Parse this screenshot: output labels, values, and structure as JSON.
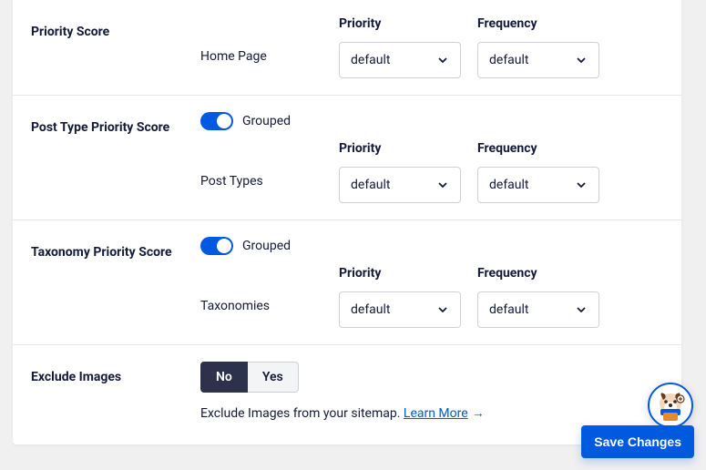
{
  "sections": {
    "priority": {
      "label": "Priority Score",
      "row_label": "Home Page",
      "priority_head": "Priority",
      "frequency_head": "Frequency",
      "priority_value": "default",
      "frequency_value": "default"
    },
    "post_type": {
      "label": "Post Type Priority Score",
      "grouped_label": "Grouped",
      "row_label": "Post Types",
      "priority_head": "Priority",
      "frequency_head": "Frequency",
      "priority_value": "default",
      "frequency_value": "default"
    },
    "taxonomy": {
      "label": "Taxonomy Priority Score",
      "grouped_label": "Grouped",
      "row_label": "Taxonomies",
      "priority_head": "Priority",
      "frequency_head": "Frequency",
      "priority_value": "default",
      "frequency_value": "default"
    },
    "exclude": {
      "label": "Exclude Images",
      "no": "No",
      "yes": "Yes",
      "help_pre": "Exclude Images from your sitemap. ",
      "learn_more": "Learn More",
      "arrow": "→"
    }
  },
  "footer": {
    "save": "Save Changes"
  }
}
